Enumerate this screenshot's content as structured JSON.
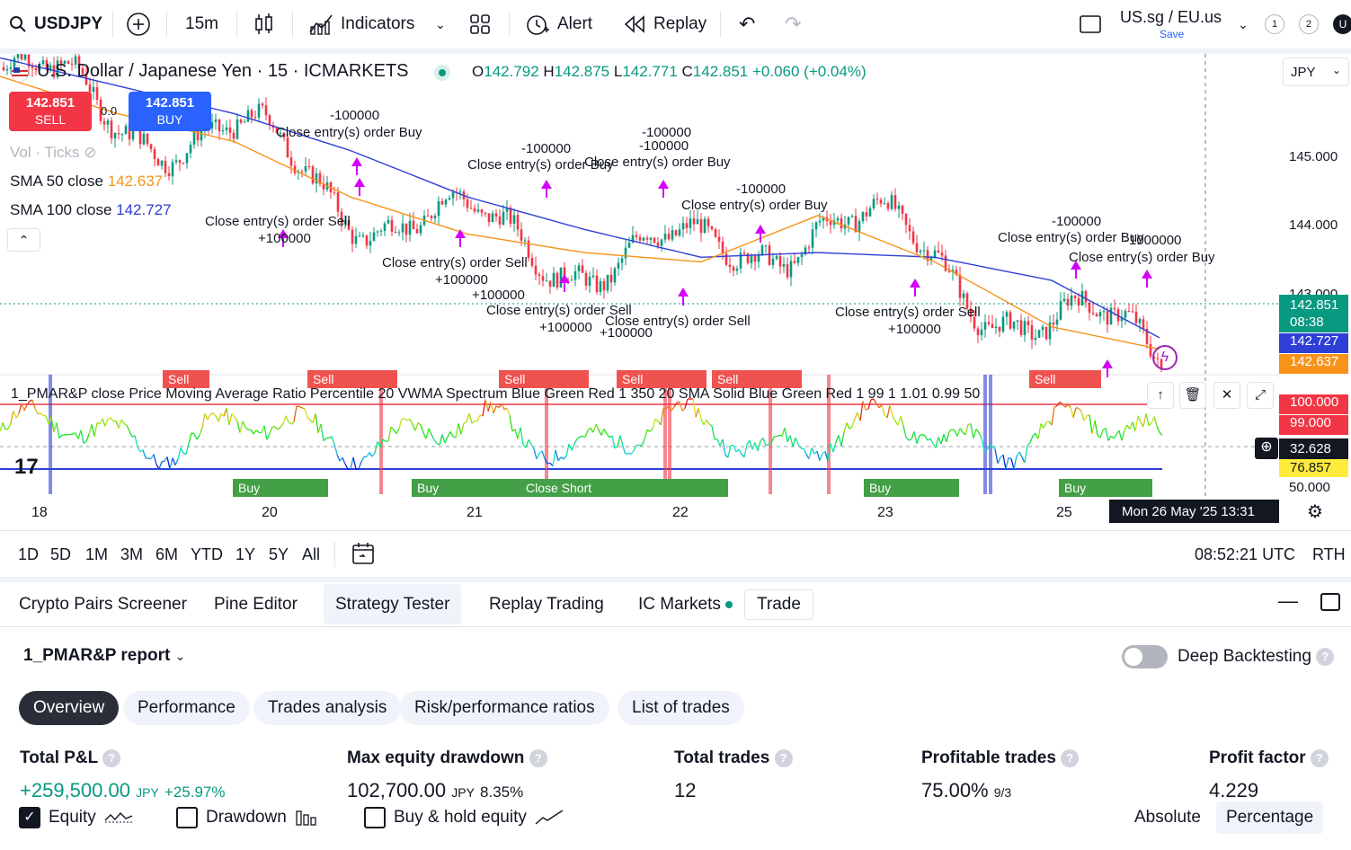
{
  "toolbar": {
    "symbol": "USDJPY",
    "interval": "15m",
    "indicators_label": "Indicators",
    "alert_label": "Alert",
    "replay_label": "Replay",
    "layout_name": "US.sg / EU.us",
    "layout_save": "Save",
    "notif_1": "1",
    "notif_2": "2",
    "avatar_letter": "U"
  },
  "chart": {
    "title": "U.S. Dollar / Japanese Yen · 15 · ICMARKETS",
    "ohlc": {
      "o": "142.792",
      "h": "142.875",
      "l": "142.771",
      "c": "142.851",
      "change": "+0.060 (+0.04%)"
    },
    "sell_price": "142.851",
    "sell_label": "SELL",
    "buy_price": "142.851",
    "buy_label": "BUY",
    "spread": "0.0",
    "vol_label": "Vol · Ticks",
    "sma50_label": "SMA 50 close",
    "sma50_value": "142.637",
    "sma100_label": "SMA 100 close",
    "sma100_value": "142.727",
    "currency": "JPY",
    "price_ticks": [
      "145.000",
      "144.000",
      "143.000"
    ],
    "current_price": "142.851",
    "countdown": "08:38",
    "sma100_tag": "142.727",
    "sma50_tag": "142.637",
    "osc_label": "1_PMAR&P close Price Moving Average Ratio Percentile 20 VWMA Spectrum Blue Green Red 1 350 20 SMA Solid Blue Green Red 1 99 1 1.01 0.99 50",
    "osc_ticks": [
      "100.000",
      "99.000",
      "32.628",
      "76.857",
      "50.000"
    ],
    "time_ticks": [
      "18",
      "20",
      "21",
      "22",
      "23",
      "25"
    ],
    "crosshair_time": "Mon 26 May '25   13:31",
    "annotations": [
      "-100000",
      "Close entry(s) order Buy",
      "-100000",
      "Close entry(s) order Buy",
      "-100000",
      "-100000",
      "Close entry(s) order Buy",
      "-100000",
      "Close entry(s) order Buy",
      "Close entry(s) order Sell",
      "+100000",
      "Close entry(s) order Sell",
      "+100000",
      "+100000",
      "Close entry(s) order Sell",
      "+100000",
      "Close entry(s) order Sell",
      "+100000",
      "Close entry(s) order Sell",
      "+100000",
      "-100000",
      "Close entry(s) order Buy",
      "-1000000",
      "Close entry(s) order Buy"
    ],
    "markers": {
      "sell": "Sell",
      "buy": "Buy",
      "close_short": "Close Short"
    }
  },
  "rangebar": {
    "ranges": [
      "1D",
      "5D",
      "1M",
      "3M",
      "6M",
      "YTD",
      "1Y",
      "5Y",
      "All"
    ],
    "clock": "08:52:21 UTC",
    "session": "RTH"
  },
  "panel": {
    "tabs": [
      "Crypto Pairs Screener",
      "Pine Editor",
      "Strategy Tester",
      "Replay Trading",
      "IC Markets",
      "Trade"
    ]
  },
  "report": {
    "title": "1_PMAR&P report",
    "deep_label": "Deep Backtesting",
    "tabs": [
      "Overview",
      "Performance",
      "Trades analysis",
      "Risk/performance ratios",
      "List of trades"
    ],
    "metrics": {
      "pnl_title": "Total P&L",
      "pnl_value": "+259,500.00",
      "pnl_ccy": "JPY",
      "pnl_pct": "+25.97%",
      "dd_title": "Max equity drawdown",
      "dd_value": "102,700.00",
      "dd_ccy": "JPY",
      "dd_pct": "8.35%",
      "trades_title": "Total trades",
      "trades_value": "12",
      "prof_title": "Profitable trades",
      "prof_value": "75.00%",
      "prof_ratio": "9/3",
      "pf_title": "Profit factor",
      "pf_value": "4.229"
    },
    "checks": {
      "equity": "Equity",
      "drawdown": "Drawdown",
      "buyhold": "Buy & hold equity"
    },
    "modes": {
      "absolute": "Absolute",
      "percentage": "Percentage"
    }
  },
  "colors": {
    "up": "#089981",
    "down": "#f23645",
    "sma50": "#f7931a",
    "sma100": "#2f3fd6",
    "marker_buy": "#43a047",
    "marker_sell": "#ef5350",
    "strategy": "#d500f9"
  },
  "chart_data": {
    "type": "line",
    "series": [
      {
        "name": "SMA 50 close",
        "x": [
          0,
          10,
          20,
          30,
          40,
          50,
          60,
          70,
          80,
          90,
          100
        ],
        "values": [
          145.6,
          145.2,
          144.9,
          144.3,
          143.9,
          143.7,
          143.6,
          144.1,
          143.6,
          142.9,
          142.64
        ]
      },
      {
        "name": "SMA 100 close",
        "x": [
          0,
          10,
          20,
          30,
          40,
          50,
          60,
          70,
          80,
          90,
          100
        ],
        "values": [
          145.8,
          145.5,
          145.2,
          144.8,
          144.3,
          143.95,
          143.65,
          143.7,
          143.65,
          143.4,
          142.73
        ]
      }
    ],
    "ylim": [
      142.5,
      145.6
    ]
  }
}
